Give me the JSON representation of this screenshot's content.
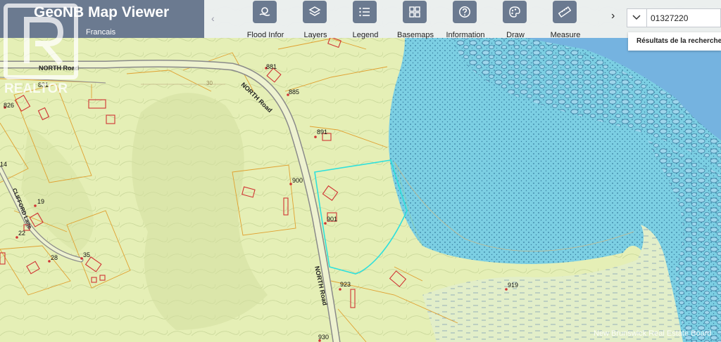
{
  "app": {
    "title": "GeoNB Map Viewer",
    "language_link": "Francais"
  },
  "toolbar": {
    "back_icon": "chevron-left-icon",
    "next_icon": "chevron-right-icon",
    "tools": [
      {
        "id": "flood",
        "label": "Flood Infor",
        "icon": "flood-icon"
      },
      {
        "id": "layers",
        "label": "Layers",
        "icon": "layers-icon"
      },
      {
        "id": "legend",
        "label": "Legend",
        "icon": "list-icon"
      },
      {
        "id": "basemaps",
        "label": "Basemaps",
        "icon": "grid-icon"
      },
      {
        "id": "information",
        "label": "Information",
        "icon": "question-icon"
      },
      {
        "id": "draw",
        "label": "Draw",
        "icon": "palette-icon"
      },
      {
        "id": "measure",
        "label": "Measure",
        "icon": "ruler-icon"
      }
    ],
    "accent_color": "#6b7a90"
  },
  "search": {
    "value": "01327220",
    "dropdown_icon": "chevron-down-icon",
    "results_label": "Résultats de la recherche"
  },
  "map": {
    "colors": {
      "land": "#e5efb6",
      "water": "#7ccfe3",
      "lake": "#75b3e0",
      "selected_parcel": "#2ee0dc",
      "parcel_line": "#e0a030",
      "building": "#d03434"
    },
    "road_labels": {
      "north_road_top": "NORTH Road",
      "north_road_mid": "NORTH Road",
      "north_road_bottom": "NORTH Road",
      "clifford_lane": "CLIFFORD Lane"
    },
    "address_labels": {
      "a881": "881",
      "a885": "885",
      "a891": "891",
      "a900": "900",
      "a901": "901",
      "a923": "923",
      "a919": "919",
      "a930": "930",
      "a826": "826",
      "a831": "831",
      "a19": "19",
      "a22": "22",
      "a28": "28",
      "a35": "35",
      "a14": "14",
      "contour30": "30"
    }
  },
  "watermarks": {
    "realtor": "REALTOR",
    "board": "New Brunswick Real Estate Board"
  }
}
